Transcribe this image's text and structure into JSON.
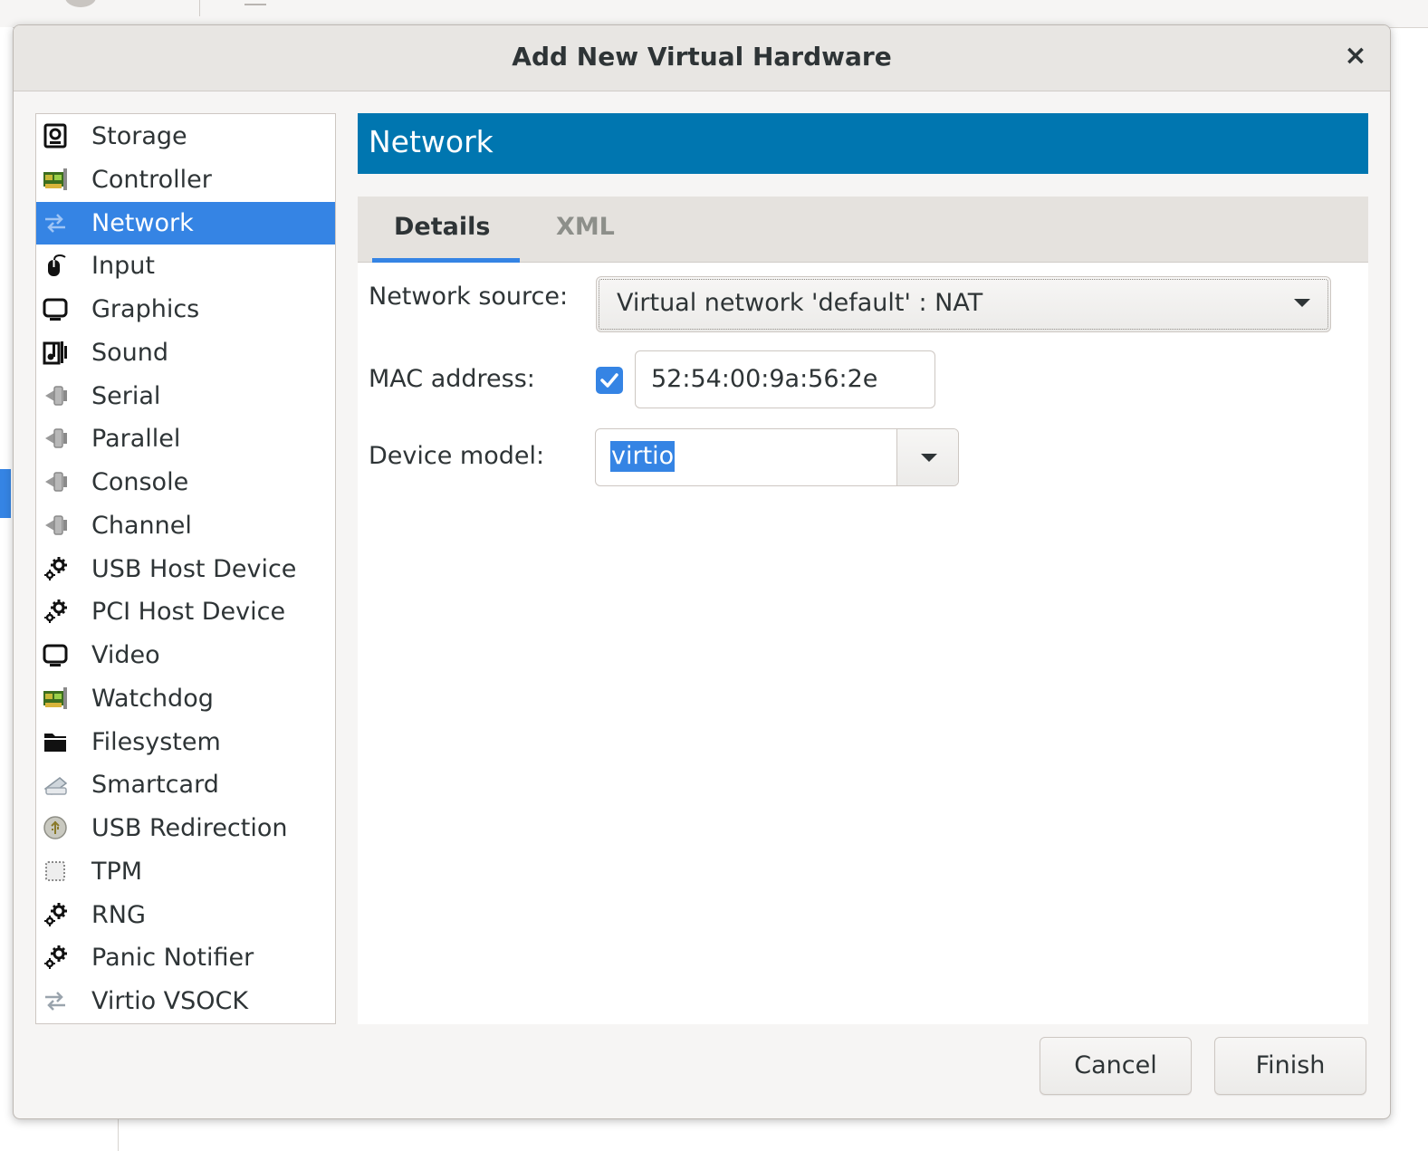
{
  "dialog": {
    "title": "Add New Virtual Hardware",
    "close_glyph": "×"
  },
  "hardware_list": {
    "items": [
      {
        "label": "Storage",
        "icon": "disk-icon"
      },
      {
        "label": "Controller",
        "icon": "card-icon"
      },
      {
        "label": "Network",
        "icon": "arrows-icon",
        "selected": true
      },
      {
        "label": "Input",
        "icon": "mouse-icon"
      },
      {
        "label": "Graphics",
        "icon": "monitor-icon"
      },
      {
        "label": "Sound",
        "icon": "audio-card-icon"
      },
      {
        "label": "Serial",
        "icon": "plug-icon"
      },
      {
        "label": "Parallel",
        "icon": "plug-icon"
      },
      {
        "label": "Console",
        "icon": "plug-icon"
      },
      {
        "label": "Channel",
        "icon": "plug-icon"
      },
      {
        "label": "USB Host Device",
        "icon": "gears-icon"
      },
      {
        "label": "PCI Host Device",
        "icon": "gears-icon"
      },
      {
        "label": "Video",
        "icon": "monitor-icon"
      },
      {
        "label": "Watchdog",
        "icon": "card-icon"
      },
      {
        "label": "Filesystem",
        "icon": "folder-icon"
      },
      {
        "label": "Smartcard",
        "icon": "smartcard-icon"
      },
      {
        "label": "USB Redirection",
        "icon": "usb-icon"
      },
      {
        "label": "TPM",
        "icon": "chip-icon"
      },
      {
        "label": "RNG",
        "icon": "gears-icon"
      },
      {
        "label": "Panic Notifier",
        "icon": "gears-icon"
      },
      {
        "label": "Virtio VSOCK",
        "icon": "arrows-icon"
      }
    ]
  },
  "section": {
    "title": "Network"
  },
  "tabs": [
    {
      "label": "Details",
      "active": true
    },
    {
      "label": "XML",
      "active": false
    }
  ],
  "form": {
    "network_source_label": "Network source:",
    "network_source_value": "Virtual network 'default' : NAT",
    "mac_label": "MAC address:",
    "mac_checked": true,
    "mac_value": "52:54:00:9a:56:2e",
    "device_model_label": "Device model:",
    "device_model_value": "virtio"
  },
  "buttons": {
    "cancel": "Cancel",
    "finish": "Finish"
  },
  "colors": {
    "accent": "#3584e4",
    "header": "#0076b0"
  }
}
